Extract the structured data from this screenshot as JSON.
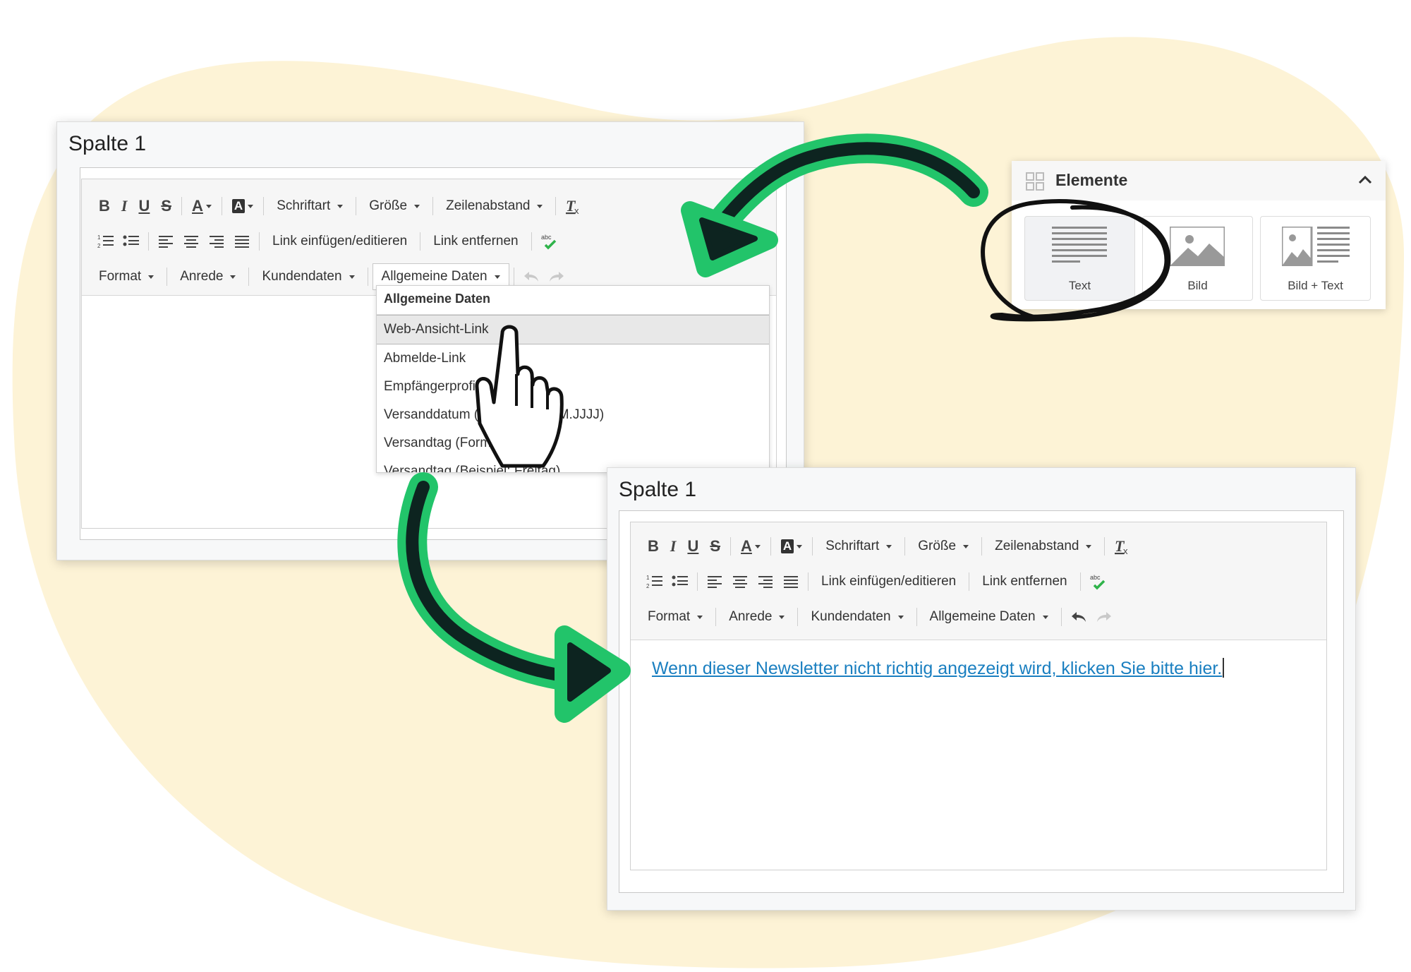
{
  "panel_top": {
    "title": "Spalte 1",
    "toolbar": {
      "bold": "B",
      "italic": "I",
      "underline": "U",
      "strike": "S",
      "font_color": "A",
      "bg_color": "A",
      "schriftart": "Schriftart",
      "groesse": "Größe",
      "zeilenabstand": "Zeilenabstand",
      "link_edit": "Link einfügen/editieren",
      "link_remove": "Link entfernen",
      "format": "Format",
      "anrede": "Anrede",
      "kundendaten": "Kundendaten",
      "allgemeine_daten": "Allgemeine Daten"
    },
    "dropdown": {
      "header": "Allgemeine Daten",
      "items": [
        "Web-Ansicht-Link",
        "Abmelde-Link",
        "Empfängerprofil",
        "Versanddatum (Format: TT.MM.JJJJ)",
        "Versandtag (Format: TT)",
        "Versandtag (Beispiel: Freitag)"
      ]
    }
  },
  "panel_bottom": {
    "title": "Spalte 1",
    "toolbar": {
      "bold": "B",
      "italic": "I",
      "underline": "U",
      "strike": "S",
      "font_color": "A",
      "bg_color": "A",
      "schriftart": "Schriftart",
      "groesse": "Größe",
      "zeilenabstand": "Zeilenabstand",
      "link_edit": "Link einfügen/editieren",
      "link_remove": "Link entfernen",
      "format": "Format",
      "anrede": "Anrede",
      "kundendaten": "Kundendaten",
      "allgemeine_daten": "Allgemeine Daten"
    },
    "content_link": "Wenn dieser Newsletter nicht richtig angezeigt wird, klicken Sie bitte hier."
  },
  "elements": {
    "title": "Elemente",
    "tiles": [
      "Text",
      "Bild",
      "Bild + Text"
    ]
  },
  "colors": {
    "background_blob": "#fdf3d6",
    "arrow_green": "#22c46a",
    "arrow_dark": "#0d2420",
    "link_blue": "#1a7fc0"
  }
}
